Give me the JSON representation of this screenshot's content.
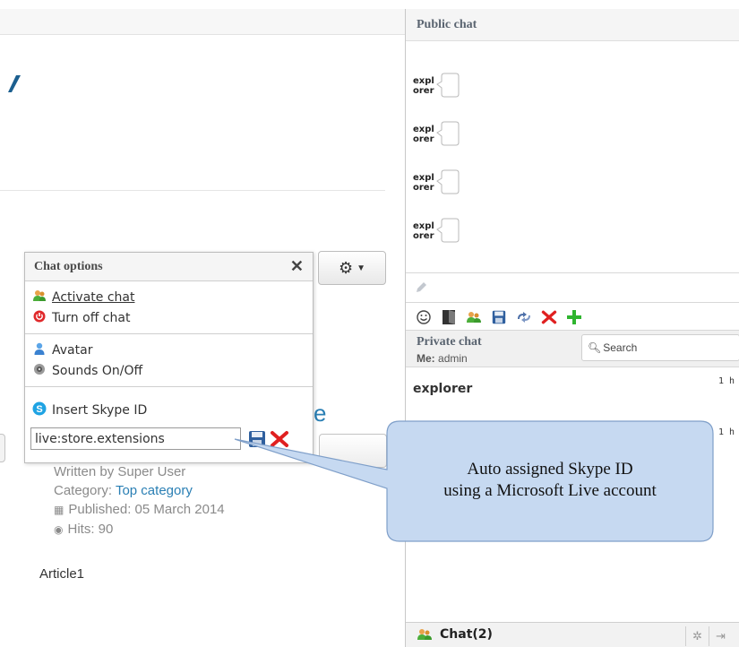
{
  "page": {
    "gear_button": "⚙",
    "title_fragment": "e",
    "article_info": {
      "written_by": "Written by Super User",
      "category_label": "Category:",
      "category_value": "Top category",
      "published": "Published: 05 March 2014",
      "hits": "Hits: 90"
    },
    "article_body": "Article1"
  },
  "chat_options": {
    "title": "Chat options",
    "close": "✕",
    "items": [
      {
        "label": "Activate chat",
        "icon": "users-icon"
      },
      {
        "label": "Turn off chat",
        "icon": "power-icon"
      },
      {
        "label": "Avatar",
        "icon": "avatar-icon"
      },
      {
        "label": "Sounds On/Off",
        "icon": "sound-icon"
      },
      {
        "label": "Insert Skype ID",
        "icon": "skype-icon"
      }
    ],
    "skype_input_value": "live:store.extensions"
  },
  "chat_panel": {
    "public_title": "Public chat",
    "public_messages": [
      {
        "user": "explorer"
      },
      {
        "user": "explorer"
      },
      {
        "user": "explorer"
      },
      {
        "user": "explorer"
      }
    ],
    "toolbar_icons": [
      "smiley-icon",
      "door-icon",
      "users-icon",
      "save-icon",
      "refresh-icon",
      "delete-icon",
      "add-icon"
    ],
    "private_title": "Private chat",
    "me_label": "Me:",
    "me_value": "admin",
    "search_placeholder": "Search",
    "private_rows": [
      {
        "name": "explorer",
        "time": "1 h"
      },
      {
        "name": "",
        "time": "1 h"
      }
    ],
    "chat_bar_label": "Chat(2)"
  },
  "callout": {
    "line1": "Auto assigned Skype ID",
    "line2": "using a Microsoft Live account"
  },
  "colors": {
    "link": "#2a7fb4",
    "callout_fill": "#c6d9f1",
    "callout_stroke": "#7f9fc9",
    "delete_red": "#e02020",
    "add_green": "#2fb52f"
  }
}
